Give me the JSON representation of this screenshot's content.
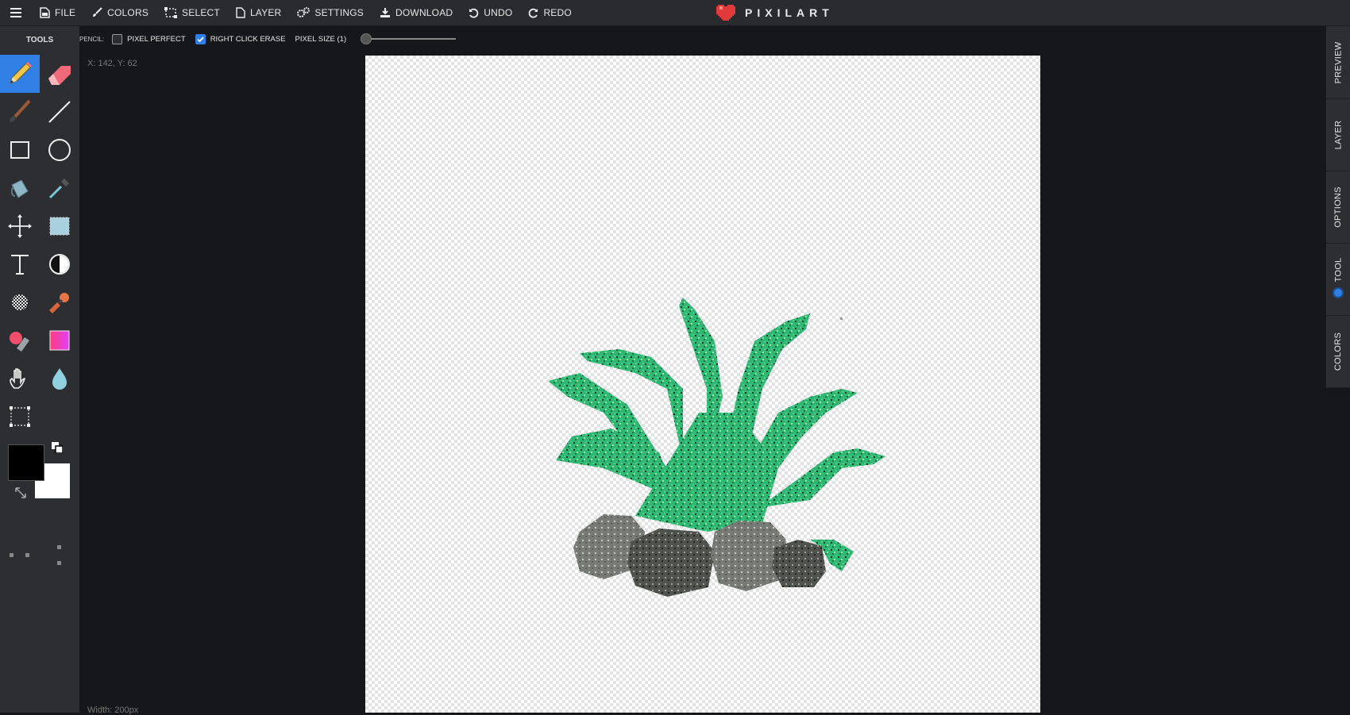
{
  "topbar": {
    "menu_icon": "hamburger-icon",
    "items": [
      {
        "label": "FILE",
        "icon": "file-icon"
      },
      {
        "label": "COLORS",
        "icon": "brush-icon"
      },
      {
        "label": "SELECT",
        "icon": "select-icon"
      },
      {
        "label": "LAYER",
        "icon": "layer-icon"
      },
      {
        "label": "SETTINGS",
        "icon": "gears-icon"
      },
      {
        "label": "DOWNLOAD",
        "icon": "download-icon"
      },
      {
        "label": "UNDO",
        "icon": "undo-icon"
      },
      {
        "label": "REDO",
        "icon": "redo-icon"
      }
    ],
    "logo_text": "PIXILART"
  },
  "tools": {
    "title": "TOOLS",
    "items": [
      "pencil-icon",
      "eraser-icon",
      "brush-icon",
      "line-icon",
      "rectangle-icon",
      "circle-icon",
      "bucket-icon",
      "eyedropper-icon",
      "move-icon",
      "select-rect-icon",
      "text-icon",
      "lighten-darken-icon",
      "dither-icon",
      "stamp-icon",
      "color-replace-icon",
      "gradient-icon",
      "hand-icon",
      "blur-drop-icon",
      "crop-icon"
    ],
    "active": "pencil-icon",
    "primary_color": "#000000",
    "secondary_color": "#ffffff"
  },
  "options": {
    "tool_label": "PENCIL:",
    "pixel_perfect_label": "PIXEL PERFECT",
    "pixel_perfect_checked": false,
    "right_click_erase_label": "RIGHT CLICK ERASE",
    "right_click_erase_checked": true,
    "pixel_size_label": "PIXEL SIZE (1)",
    "pixel_size_value": 1
  },
  "status": {
    "coords": "X: 142, Y: 62",
    "width": "Width: 200px"
  },
  "right_tabs": [
    "PREVIEW",
    "LAYER",
    "OPTIONS",
    "TOOL",
    "COLORS"
  ],
  "colors": {
    "accent": "#2f7fe4",
    "plant_green": "#2fb874",
    "rock_gray": "#6f716c"
  }
}
